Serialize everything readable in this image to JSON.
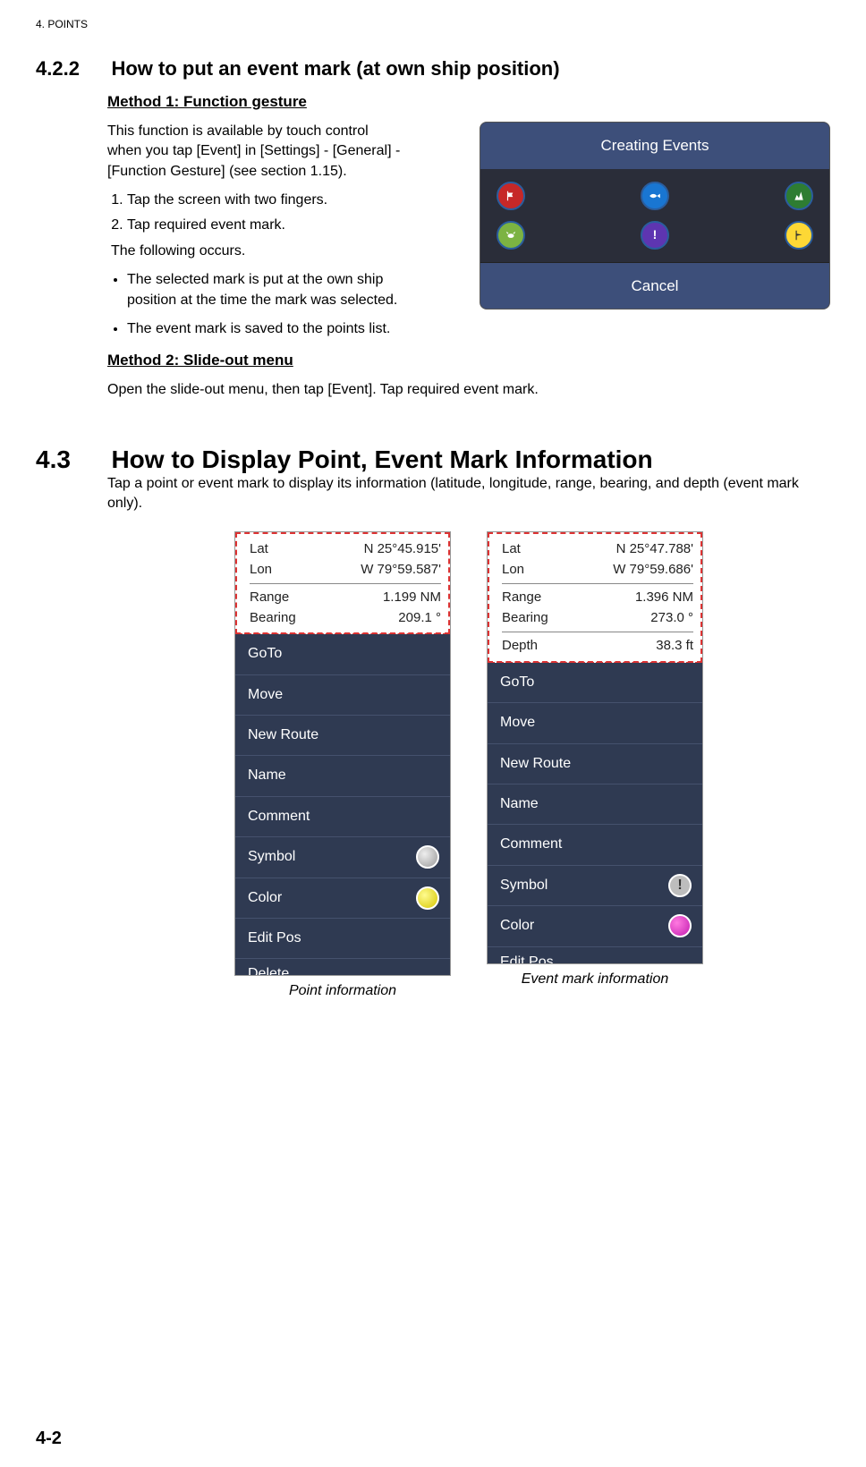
{
  "header": "4.  POINTS",
  "s422": {
    "num": "4.2.2",
    "title": "How to put an event mark (at own ship position)",
    "method1_title": "Method 1: Function gesture",
    "para1": "This function is available by touch control when you tap [Event] in [Settings] - [General] - [Function Gesture] (see section 1.15).",
    "step1": "Tap the screen with two fingers.",
    "step2": "Tap required event mark.",
    "follow": "The following occurs.",
    "bullet1": "The selected mark is put at the own ship position at the time the mark was selected.",
    "bullet2": "The event mark is saved to the points list.",
    "method2_title": "Method 2: Slide-out menu",
    "method2_body": "Open the slide-out menu, then tap [Event]. Tap required event mark."
  },
  "events_dialog": {
    "title": "Creating Events",
    "cancel": "Cancel",
    "icons": [
      "flag",
      "fish",
      "reef",
      "crab",
      "excl",
      "flag2"
    ]
  },
  "s43": {
    "num": "4.3",
    "title": "How to Display Point, Event Mark Information",
    "body": "Tap a point or event mark to display its information (latitude, longitude, range, bearing, and depth (event mark only)."
  },
  "point_info": {
    "lat_label": "Lat",
    "lat_val": "N 25°45.915'",
    "lon_label": "Lon",
    "lon_val": "W 79°59.587'",
    "range_label": "Range",
    "range_val": "1.199 NM",
    "bearing_label": "Bearing",
    "bearing_val": "209.1 °",
    "menu": {
      "goto": "GoTo",
      "move": "Move",
      "newroute": "New Route",
      "name": "Name",
      "comment": "Comment",
      "symbol": "Symbol",
      "color": "Color",
      "editpos": "Edit Pos",
      "cut": "Delete"
    },
    "caption": "Point information"
  },
  "event_info": {
    "lat_label": "Lat",
    "lat_val": "N 25°47.788'",
    "lon_label": "Lon",
    "lon_val": "W 79°59.686'",
    "range_label": "Range",
    "range_val": "1.396 NM",
    "bearing_label": "Bearing",
    "bearing_val": "273.0 °",
    "depth_label": "Depth",
    "depth_val": "38.3 ft",
    "menu": {
      "goto": "GoTo",
      "move": "Move",
      "newroute": "New Route",
      "name": "Name",
      "comment": "Comment",
      "symbol": "Symbol",
      "color": "Color",
      "cut": "Edit Pos"
    },
    "caption": "Event mark information"
  },
  "page_num": "4-2"
}
